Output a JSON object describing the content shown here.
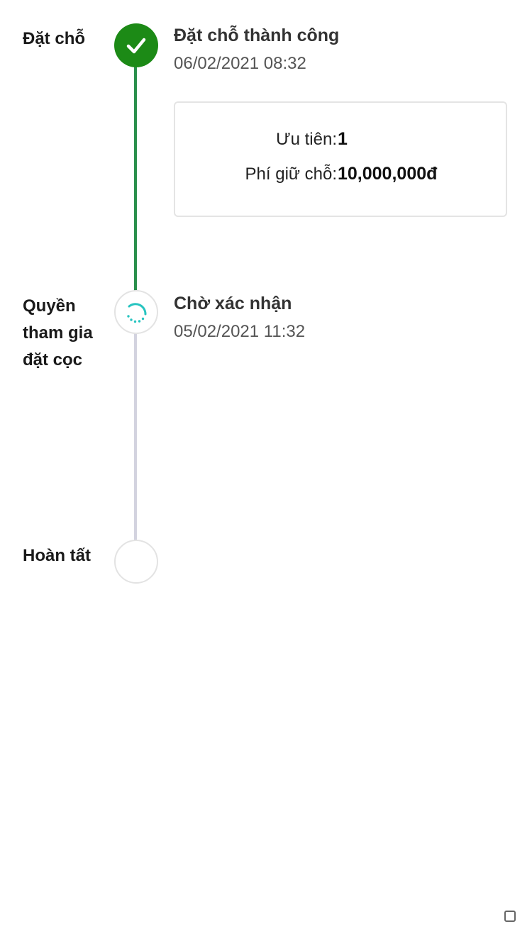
{
  "steps": [
    {
      "label": "Đặt chỗ",
      "status": "done",
      "event_title": "Đặt chỗ thành công",
      "event_time": "06/02/2021 08:32",
      "details": [
        {
          "label": "Ưu tiên:",
          "value": "1"
        },
        {
          "label": "Phí giữ chỗ:",
          "value": "10,000,000đ"
        }
      ]
    },
    {
      "label": "Quyền tham gia đặt cọc",
      "status": "in-progress",
      "event_title": "Chờ xác nhận",
      "event_time": "05/02/2021 11:32"
    },
    {
      "label": "Hoàn tất",
      "status": "pending"
    }
  ],
  "icons": {
    "done": "check-icon",
    "in_progress": "spinner-icon"
  },
  "colors": {
    "done_node": "#1c8a16",
    "done_line": "#2a8f4c",
    "pending_line": "#d3d3df",
    "spinner": "#27c4c0"
  }
}
